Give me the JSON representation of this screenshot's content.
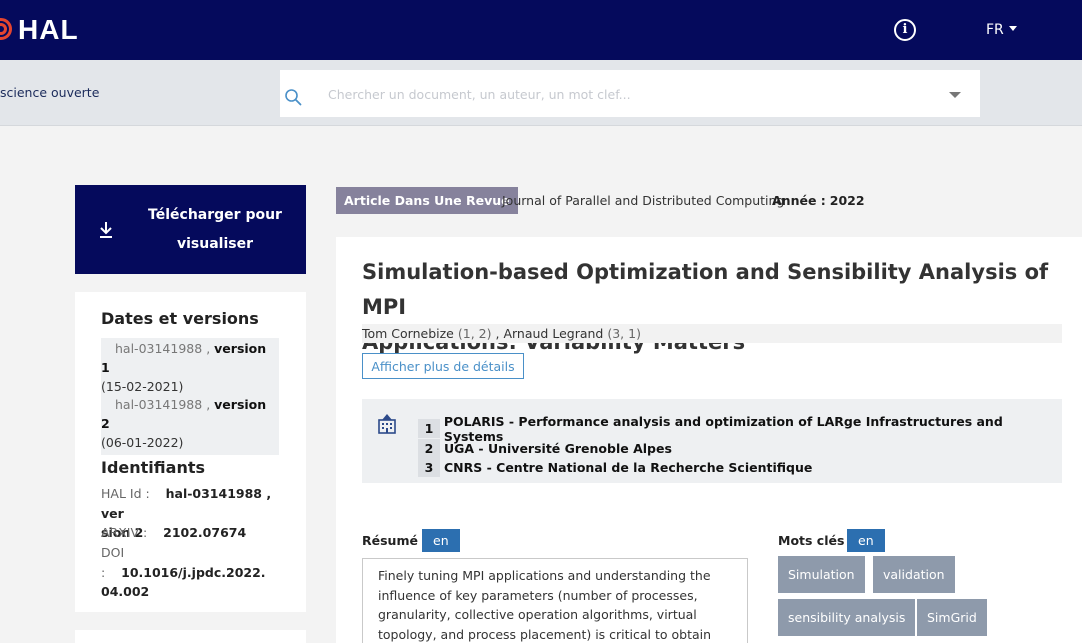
{
  "header": {
    "logo_text": "HAL",
    "brand_color": "#050a5c",
    "logo_accent": "#e5452f",
    "info_icon": "info-icon",
    "language": "FR"
  },
  "subheader": {
    "tagline": "science ouverte",
    "search": {
      "icon": "search-icon",
      "placeholder": "Chercher un document, un auteur, un mot clef..."
    }
  },
  "sidebar": {
    "download": {
      "icon": "download-icon",
      "label_line1": "Télécharger pour",
      "label_line2": "visualiser"
    },
    "dates_versions": {
      "title": "Dates et versions",
      "versions": [
        {
          "id": "hal-03141988",
          "sep": ",",
          "label": "version 1",
          "date": "(15-02-2021)"
        },
        {
          "id": "hal-03141988",
          "sep": ",",
          "label": "version 2",
          "date": "(06-01-2022)"
        }
      ]
    },
    "identifiers": {
      "title": "Identifiants",
      "hal_key": "HAL Id :",
      "hal_value_1": "hal-03141988 , ver",
      "hal_value_2": "sion 2",
      "arxiv_key": "ARXIV :",
      "arxiv_value": "2102.07674",
      "doi_key": "DOI :",
      "doi_value_1": "10.1016/j.jpdc.2022.",
      "doi_value_2": "04.002"
    }
  },
  "doc_meta": {
    "type": "Article Dans Une Revue",
    "journal": "Journal of Parallel and Distributed Computing",
    "year_label": "Année :",
    "year": "2022"
  },
  "article": {
    "title_line1": "Simulation-based Optimization and Sensibility Analysis of MPI",
    "title_line2": "Applications: Variability Matters",
    "authors": [
      {
        "name": "Tom Cornebize",
        "aff": "(1, 2)"
      },
      {
        "name": "Arnaud Legrand",
        "aff": "(3, 1)"
      }
    ],
    "author_sep": ",",
    "details_button": "Afficher plus de détails",
    "affiliations_icon": "building-icon",
    "affiliations": [
      {
        "num": "1",
        "name": "POLARIS - Performance analysis and optimization of LARge Infrastructures and Systems"
      },
      {
        "num": "2",
        "name": "UGA - Université Grenoble Alpes"
      },
      {
        "num": "3",
        "name": "CNRS - Centre National de la Recherche Scientifique"
      }
    ],
    "abstract": {
      "label": "Résumé",
      "lang": "en",
      "lines": [
        "Finely tuning MPI applications and understanding the",
        "influence of key parameters (number of processes,",
        "granularity, collective operation algorithms, virtual",
        "topology, and process placement) is critical to obtain"
      ]
    },
    "keywords": {
      "label": "Mots clés",
      "lang": "en",
      "items": [
        "Simulation",
        "validation",
        "sensibility analysis",
        "SimGrid"
      ]
    }
  }
}
